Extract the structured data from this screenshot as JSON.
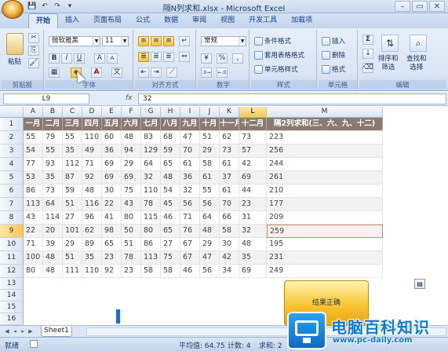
{
  "window": {
    "title": "隔N列求和.xlsx - Microsoft Excel",
    "min": "–",
    "max": "▭",
    "close": "✕"
  },
  "qat": [
    "💾",
    "↶",
    "↷",
    "▾"
  ],
  "tabs": [
    "开始",
    "插入",
    "页面布局",
    "公式",
    "数据",
    "审阅",
    "视图",
    "开发工具",
    "加载项"
  ],
  "ribbon": {
    "clipboard": {
      "paste": "粘贴",
      "label": "剪贴板"
    },
    "font": {
      "name": "微软雅黑",
      "size": "11",
      "bold": "B",
      "italic": "I",
      "underline": "U",
      "grow": "A",
      "shrink": "A",
      "fontcolor": "A",
      "label": "字体"
    },
    "align": {
      "label": "对齐方式"
    },
    "number": {
      "format": "常规",
      "pct": "%",
      "comma": ",",
      "label": "数字"
    },
    "styles": {
      "cond": "条件格式",
      "table": "套用表格格式",
      "cell": "单元格样式",
      "label": "样式"
    },
    "cells": {
      "insert": "插入",
      "delete": "删除",
      "format": "格式",
      "label": "单元格"
    },
    "editing": {
      "sum": "Σ",
      "sort": "排序和\n筛选",
      "find": "查找和\n选择",
      "label": "编辑"
    }
  },
  "formula": {
    "namebox": "L9",
    "fx": "fx",
    "value": "32"
  },
  "columns": [
    "A",
    "B",
    "C",
    "D",
    "E",
    "F",
    "G",
    "H",
    "I",
    "J",
    "K",
    "L",
    "M"
  ],
  "header_row": [
    "一月",
    "二月",
    "三月",
    "四月",
    "五月",
    "六月",
    "七月",
    "八月",
    "九月",
    "十月",
    "十一月",
    "十二月",
    "隔2列求和(三、六、九、十二)"
  ],
  "rows": [
    [
      "55",
      "79",
      "55",
      "110",
      "60",
      "48",
      "83",
      "68",
      "47",
      "51",
      "62",
      "73",
      "223"
    ],
    [
      "54",
      "55",
      "35",
      "49",
      "36",
      "94",
      "129",
      "59",
      "70",
      "29",
      "73",
      "57",
      "256"
    ],
    [
      "77",
      "93",
      "112",
      "71",
      "69",
      "29",
      "64",
      "65",
      "61",
      "58",
      "61",
      "42",
      "244"
    ],
    [
      "53",
      "35",
      "87",
      "92",
      "69",
      "69",
      "32",
      "48",
      "36",
      "61",
      "37",
      "69",
      "261"
    ],
    [
      "86",
      "73",
      "59",
      "48",
      "30",
      "75",
      "110",
      "54",
      "32",
      "55",
      "61",
      "44",
      "210"
    ],
    [
      "113",
      "64",
      "51",
      "116",
      "22",
      "43",
      "78",
      "45",
      "56",
      "56",
      "70",
      "23",
      "177"
    ],
    [
      "43",
      "114",
      "27",
      "96",
      "41",
      "80",
      "115",
      "46",
      "71",
      "64",
      "66",
      "31",
      "209"
    ],
    [
      "22",
      "20",
      "101",
      "62",
      "98",
      "50",
      "80",
      "65",
      "76",
      "48",
      "58",
      "32",
      "259"
    ],
    [
      "71",
      "39",
      "29",
      "89",
      "65",
      "51",
      "86",
      "27",
      "67",
      "29",
      "30",
      "48",
      "195"
    ],
    [
      "100",
      "48",
      "51",
      "35",
      "23",
      "78",
      "113",
      "75",
      "67",
      "47",
      "42",
      "35",
      "231"
    ],
    [
      "80",
      "48",
      "111",
      "110",
      "92",
      "23",
      "58",
      "58",
      "46",
      "56",
      "34",
      "69",
      "249"
    ]
  ],
  "row_numbers": [
    "1",
    "2",
    "3",
    "4",
    "5",
    "6",
    "7",
    "8",
    "9",
    "10",
    "11",
    "12",
    "13",
    "14",
    "15",
    "16"
  ],
  "result_label": "结果正确",
  "sheet": {
    "tab": "Sheet1"
  },
  "status": {
    "ready": "就绪",
    "avg": "平均值: 64.75",
    "count": "计数: 4",
    "sum": "求和: 2"
  },
  "watermark": {
    "cn": "电脑百科知识",
    "url": "www.pc-daily.com"
  }
}
